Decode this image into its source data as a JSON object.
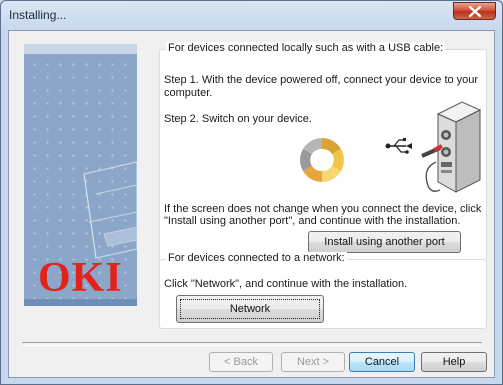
{
  "window": {
    "title": "Installing...",
    "close_glyph": "close-x-icon"
  },
  "sidebar": {
    "logo_text": "OKI",
    "logo_color": "#e3231b"
  },
  "usb_group": {
    "legend": "For devices connected locally such as with a USB cable:",
    "step1_line1": "Step 1. With the device powered off, connect your device to your",
    "step1_line2": "computer.",
    "step2": "Step 2. Switch on your device.",
    "hint_line1": "If the screen does not change when you connect the device, click",
    "hint_line2": "\"Install using another port\", and continue with the installation.",
    "install_button": "Install using another port"
  },
  "network_group": {
    "legend": "For devices connected to a network:",
    "instruction": "Click \"Network\", and continue with the installation.",
    "network_button": "Network"
  },
  "footer": {
    "back_button": "< Back",
    "next_button": "Next >",
    "cancel_button": "Cancel",
    "help_button": "Help"
  }
}
